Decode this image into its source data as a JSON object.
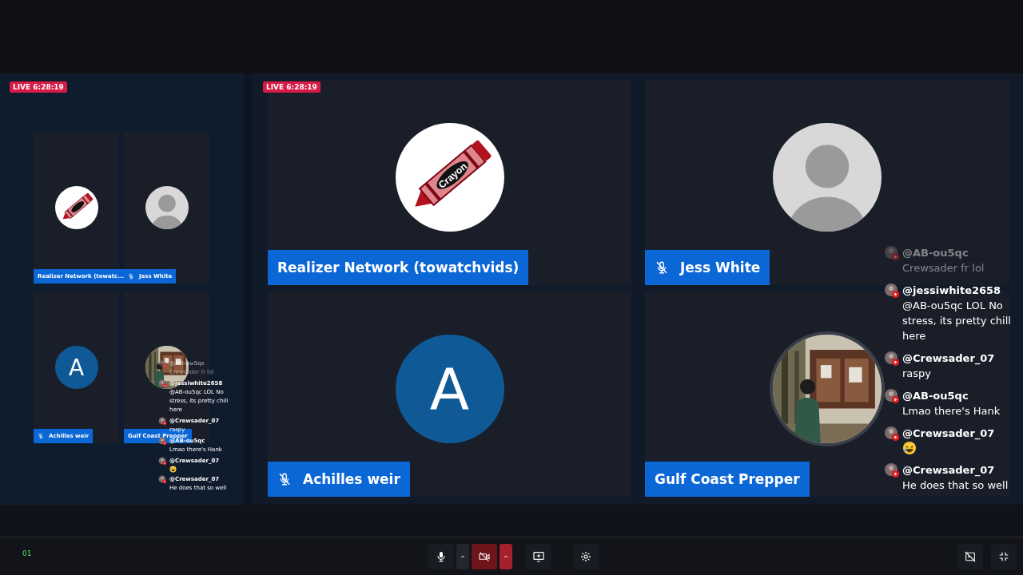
{
  "preview": {
    "live_badge": "LIVE 6:28:19",
    "tiles": [
      {
        "name": "Realizer Network (towatc...",
        "muted": false,
        "avatar": {
          "kind": "logo"
        }
      },
      {
        "name": "Jess White",
        "muted": true,
        "avatar": {
          "kind": "person"
        }
      },
      {
        "name": "Achilles weir",
        "muted": true,
        "avatar": {
          "kind": "letter",
          "letter": "A"
        }
      },
      {
        "name": "Gulf Coast Prepper",
        "muted": false
      }
    ],
    "chat": [
      {
        "kind": "text",
        "user": "@AB-ou5qc",
        "text": "Crewsader fr lol",
        "faded": true
      },
      {
        "kind": "text",
        "user": "@jessiwhite2658",
        "text": "@AB-ou5qc LOL No stress, its pretty chill here",
        "faded": false
      },
      {
        "kind": "text",
        "user": "@Crewsader_07",
        "text": "raspy",
        "faded": false
      },
      {
        "kind": "text",
        "user": "@AB-ou5qc",
        "text": "Lmao there's Hank",
        "faded": false
      },
      {
        "kind": "emoji",
        "user": "@Crewsader_07",
        "faded": false
      },
      {
        "kind": "text",
        "user": "@Crewsader_07",
        "text": "He does that so well",
        "faded": false
      }
    ]
  },
  "stage": {
    "live_badge": "LIVE 6:28:19",
    "tiles": [
      {
        "name": "Realizer Network (towatchvids)",
        "muted": false,
        "avatar": {
          "kind": "logo",
          "label": "Crayon"
        }
      },
      {
        "name": "Jess White",
        "muted": true,
        "avatar": {
          "kind": "person"
        }
      },
      {
        "name": "Achilles weir",
        "muted": true,
        "avatar": {
          "kind": "letter",
          "letter": "A"
        }
      },
      {
        "name": "Gulf Coast Prepper",
        "muted": false
      }
    ],
    "chat": [
      {
        "kind": "text",
        "user": "@AB-ou5qc",
        "text": "Crewsader fr lol",
        "faded": true
      },
      {
        "kind": "text",
        "user": "@jessiwhite2658",
        "text": "@AB-ou5qc LOL No stress, its pretty chill here",
        "faded": false
      },
      {
        "kind": "text",
        "user": "@Crewsader_07",
        "text": "raspy",
        "faded": false
      },
      {
        "kind": "text",
        "user": "@AB-ou5qc",
        "text": "Lmao there's Hank",
        "faded": false
      },
      {
        "kind": "emoji",
        "user": "@Crewsader_07",
        "faded": false
      },
      {
        "kind": "text",
        "user": "@Crewsader_07",
        "text": "He does that so well",
        "faded": false
      }
    ]
  },
  "toolbar": {
    "status": "01",
    "controls": [
      {
        "kind": "mic",
        "alert": false
      },
      {
        "kind": "caret",
        "alert": false
      },
      {
        "kind": "camera",
        "alert": true
      },
      {
        "kind": "caret",
        "alert": true
      },
      {
        "kind": "share",
        "alert": false
      },
      {
        "kind": "settings",
        "alert": false
      }
    ],
    "right_controls": [
      {
        "kind": "hide-video",
        "alert": false
      },
      {
        "kind": "collapse",
        "alert": false
      }
    ]
  }
}
